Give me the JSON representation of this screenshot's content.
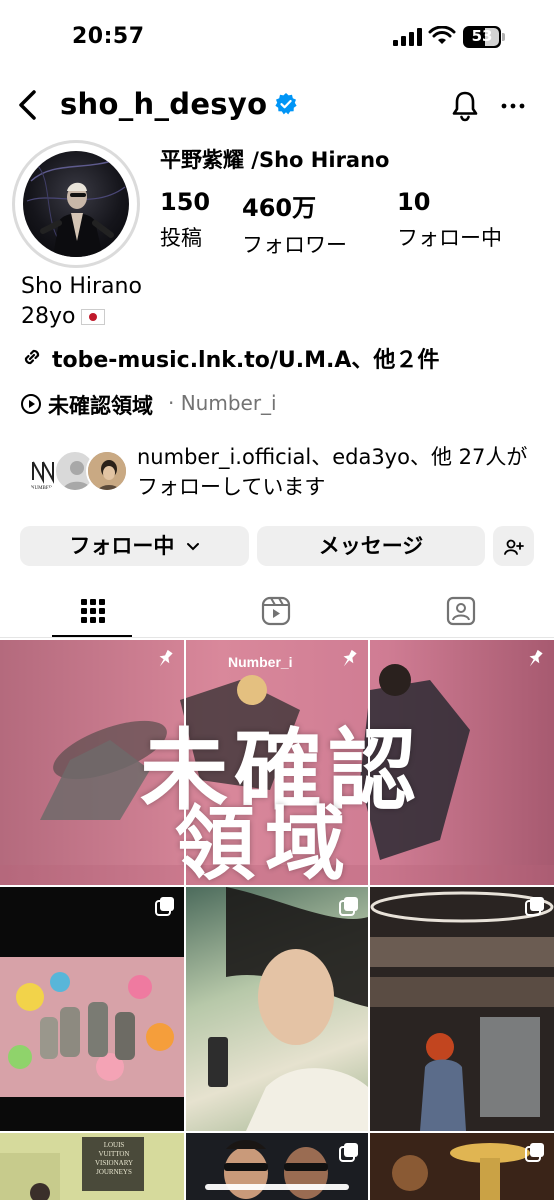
{
  "status_bar": {
    "time": "20:57",
    "battery": "53"
  },
  "header": {
    "username": "sho_h_desyo"
  },
  "profile": {
    "display_name": "平野紫耀 /Sho Hirano",
    "stats": [
      {
        "value": "150",
        "label": "投稿"
      },
      {
        "value": "460万",
        "label": "フォロワー"
      },
      {
        "value": "10",
        "label": "フォロー中"
      }
    ],
    "bio_name": "Sho Hirano",
    "bio_age": "28yo",
    "link_text": "tobe-music.lnk.to/U.M.A、他２件",
    "music_title": "未確認領域",
    "music_artist": "· Number_i",
    "mutual_text": "number_i.official、eda3yo、他 27人がフォローしています",
    "mutual_logo_text": "NUMBER I"
  },
  "buttons": {
    "follow": "フォロー中",
    "message": "メッセージ"
  },
  "grid": {
    "featured_brand": "Number_i",
    "featured_title_line1": "未確認",
    "featured_title_line2": "領域",
    "lv_text": "LOUIS VUITTON VISIONARY JOURNEYS"
  },
  "colors": {
    "verified": "#0095f6",
    "button_bg": "#efefef",
    "muted": "#737373"
  }
}
